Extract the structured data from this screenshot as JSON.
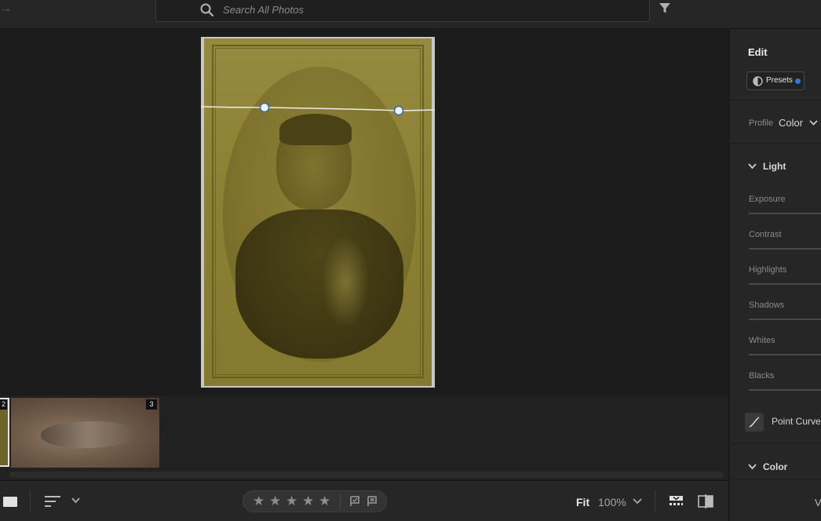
{
  "search": {
    "placeholder": "Search All Photos"
  },
  "photo": {
    "curve_points": 2
  },
  "filmstrip": {
    "thumbs": [
      {
        "badge": "2"
      },
      {
        "badge": "3"
      }
    ]
  },
  "bottombar": {
    "rating_stars": [
      "★",
      "★",
      "★",
      "★",
      "★"
    ],
    "fit_label": "Fit",
    "zoom_label": "100%"
  },
  "panel": {
    "title": "Edit",
    "presets_label": "Presets",
    "profile": {
      "label": "Profile",
      "value": "Color"
    },
    "light": {
      "title": "Light",
      "sliders": [
        "Exposure",
        "Contrast",
        "Highlights",
        "Shadows",
        "Whites",
        "Blacks"
      ]
    },
    "point_curve_label": "Point Curve",
    "color_title": "Color",
    "bottom_letter": "V"
  },
  "colors": {
    "accent": "#2b7cd8",
    "panel_bg": "#262626",
    "canvas_bg": "#1b1b1b"
  },
  "icons": {
    "search": "search-icon",
    "filter": "filter-icon",
    "presets": "presets-icon",
    "point_curve": "point-curve-icon"
  }
}
